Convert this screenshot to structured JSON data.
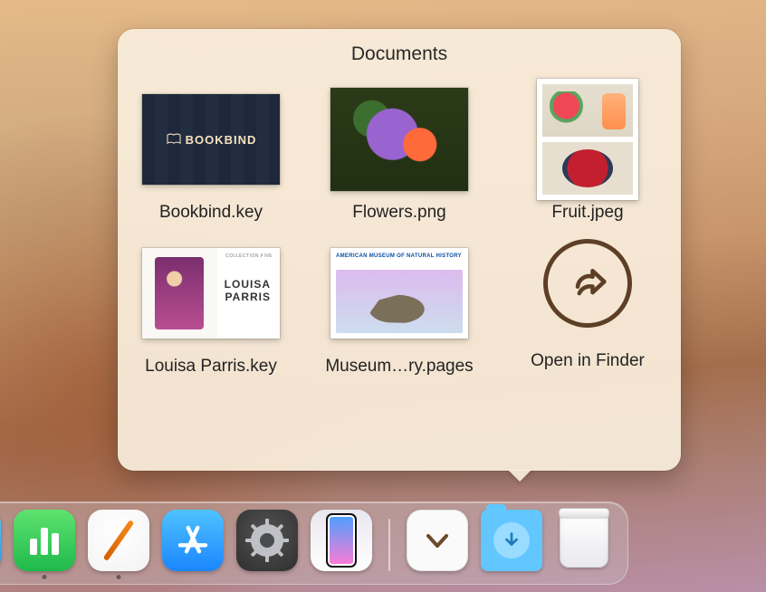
{
  "stack": {
    "title": "Documents",
    "open_in_finder": "Open in Finder",
    "items": [
      {
        "label": "Bookbind.key",
        "icon_text": "BOOKBIND"
      },
      {
        "label": "Flowers.png"
      },
      {
        "label": "Fruit.jpeg"
      },
      {
        "label": "Louisa Parris.key",
        "overlay_title": "LOUISA\nPARRIS",
        "overlay_small": "COLLECTION FIVE"
      },
      {
        "label": "Museum…ry.pages",
        "overlay_title": "AMERICAN MUSEUM OF NATURAL HISTORY"
      }
    ]
  },
  "dock": {
    "apps": [
      {
        "name": "numbers",
        "title": "Numbers"
      },
      {
        "name": "pages",
        "title": "Pages"
      },
      {
        "name": "appstore",
        "title": "App Store"
      },
      {
        "name": "settings",
        "title": "System Settings"
      },
      {
        "name": "iphone-mirror",
        "title": "iPhone Mirroring"
      }
    ],
    "right": [
      {
        "name": "recents-stack",
        "title": "Recents"
      },
      {
        "name": "downloads",
        "title": "Downloads"
      },
      {
        "name": "trash",
        "title": "Trash"
      }
    ]
  }
}
